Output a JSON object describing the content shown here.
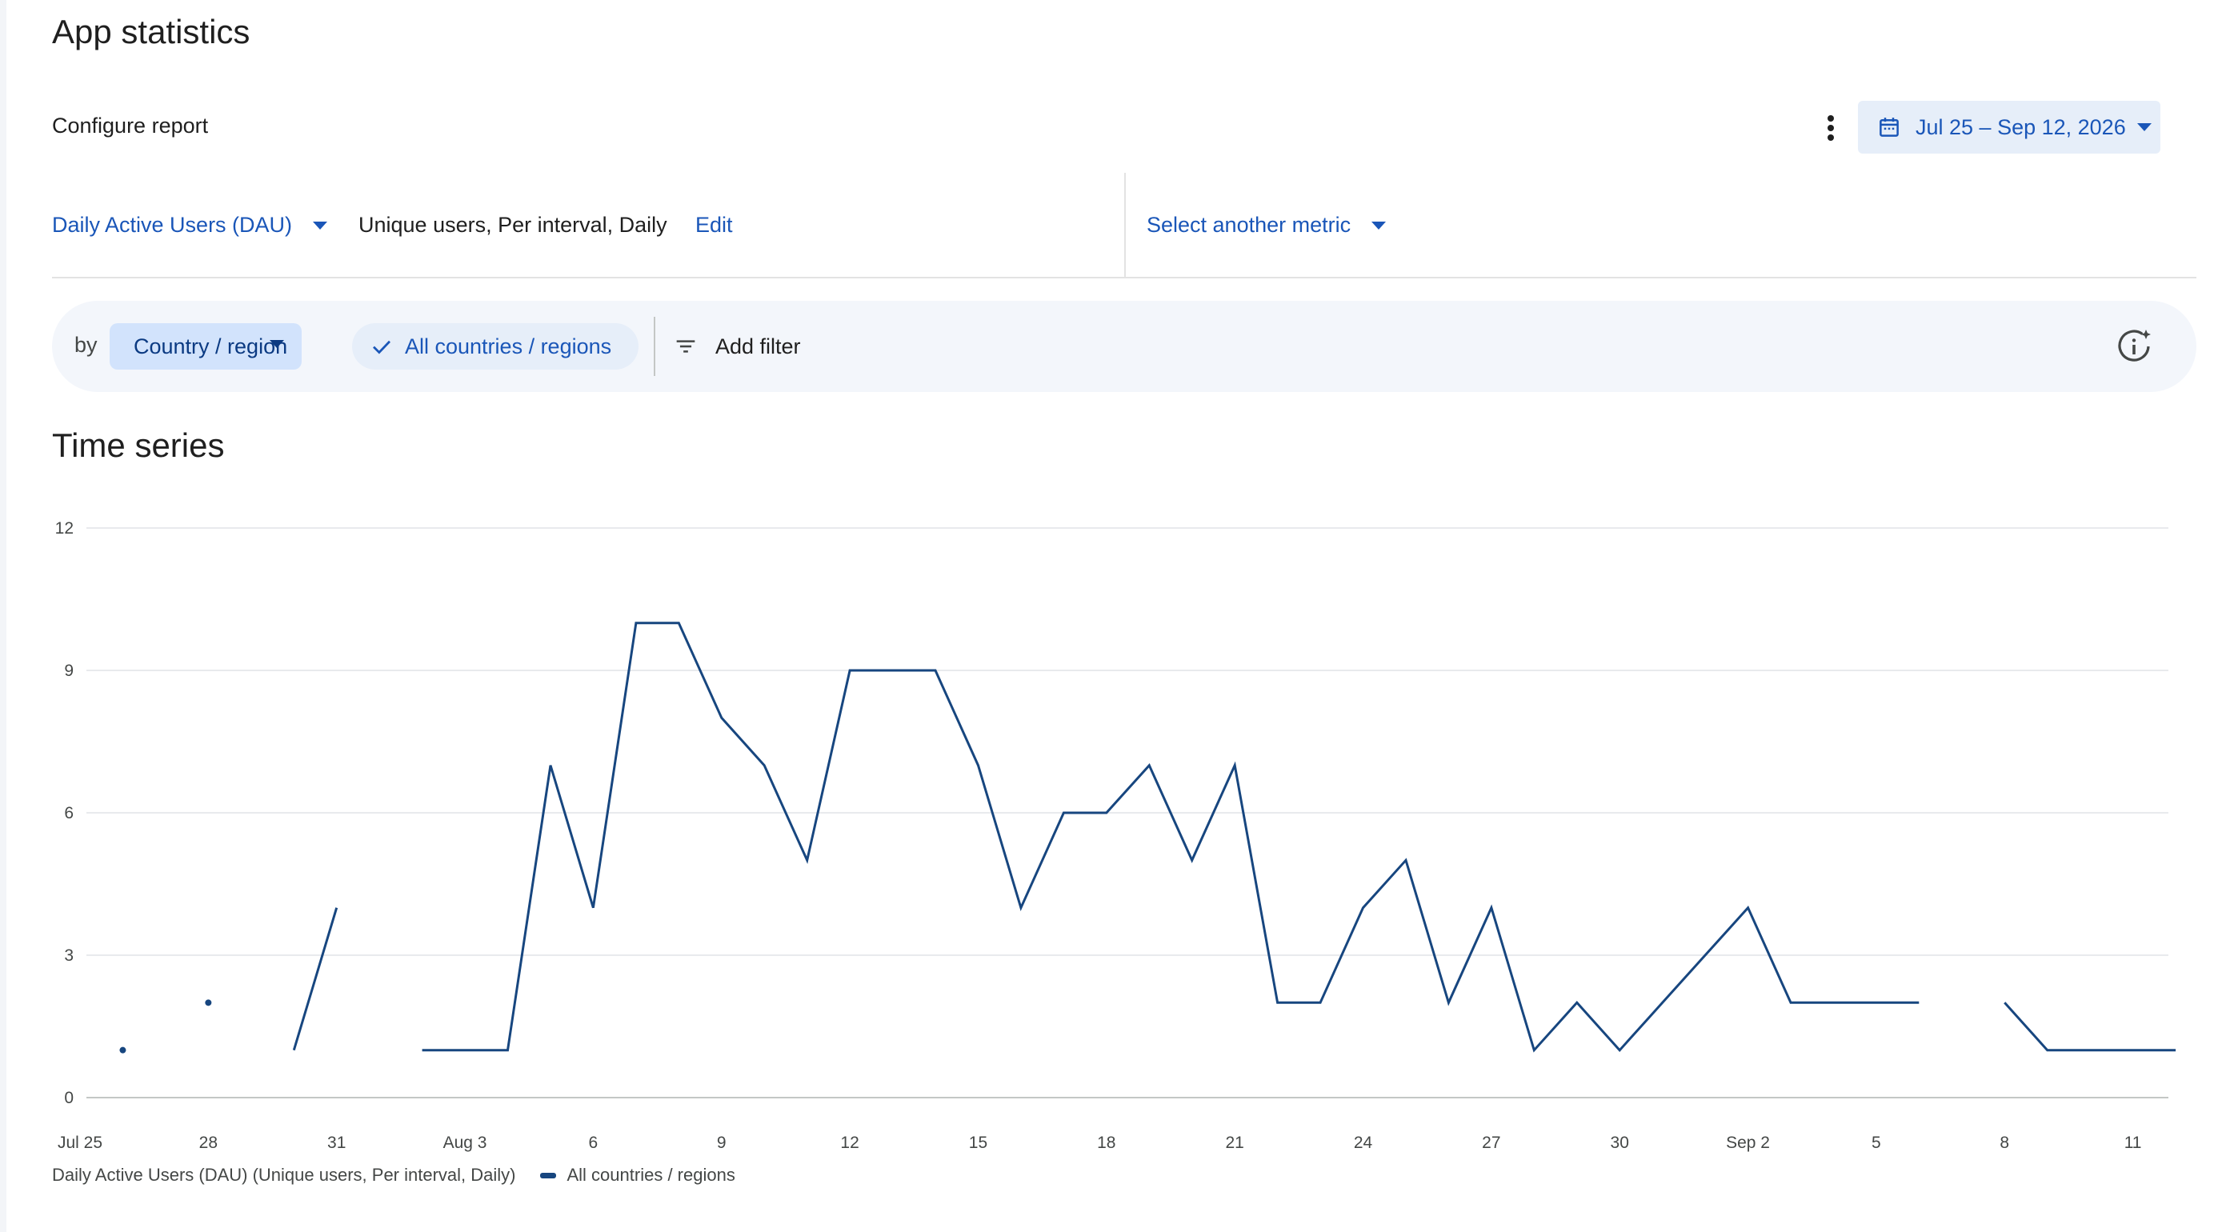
{
  "page": {
    "title": "App statistics"
  },
  "report": {
    "configure_label": "Configure report",
    "date_range": "Jul 25 – Sep 12, 2026",
    "more_icon": "more-vert-icon",
    "calendar_icon": "calendar-icon"
  },
  "metrics": {
    "primary": "Daily Active Users (DAU)",
    "description": "Unique users, Per interval, Daily",
    "edit_label": "Edit",
    "select_another": "Select another metric"
  },
  "filters": {
    "by_label": "by",
    "dimension": "Country / region",
    "selected": "All countries / regions",
    "add_filter": "Add filter",
    "insight_icon": "info-sparkle-icon"
  },
  "section": {
    "title": "Time series"
  },
  "chart_data": {
    "type": "line",
    "y_ticks": [
      "0",
      "3",
      "6",
      "9",
      "12"
    ],
    "ylim": [
      0,
      12
    ],
    "x_tick_labels": [
      "Jul 25",
      "28",
      "31",
      "Aug 3",
      "6",
      "9",
      "12",
      "15",
      "18",
      "21",
      "24",
      "27",
      "30",
      "Sep 2",
      "5",
      "8",
      "11"
    ],
    "x_start": "Jul 25",
    "x_end": "Sep 12",
    "grid": true,
    "legend_label": "Daily Active Users (DAU) (Unique users, Per interval, Daily)",
    "series": [
      {
        "name": "All countries / regions",
        "color": "#17467f",
        "dates": [
          "Jul 25",
          "Jul 26",
          "Jul 27",
          "Jul 28",
          "Jul 29",
          "Jul 30",
          "Jul 31",
          "Aug 1",
          "Aug 2",
          "Aug 3",
          "Aug 4",
          "Aug 5",
          "Aug 6",
          "Aug 7",
          "Aug 8",
          "Aug 9",
          "Aug 10",
          "Aug 11",
          "Aug 12",
          "Aug 13",
          "Aug 14",
          "Aug 15",
          "Aug 16",
          "Aug 17",
          "Aug 18",
          "Aug 19",
          "Aug 20",
          "Aug 21",
          "Aug 22",
          "Aug 23",
          "Aug 24",
          "Aug 25",
          "Aug 26",
          "Aug 27",
          "Aug 28",
          "Aug 29",
          "Aug 30",
          "Aug 31",
          "Sep 1",
          "Sep 2",
          "Sep 3",
          "Sep 4",
          "Sep 5",
          "Sep 6",
          "Sep 7",
          "Sep 8",
          "Sep 9",
          "Sep 10",
          "Sep 11",
          "Sep 12"
        ],
        "values": [
          null,
          1,
          null,
          2,
          null,
          1,
          4,
          null,
          1,
          1,
          1,
          7,
          4,
          10,
          10,
          8,
          7,
          5,
          9,
          9,
          9,
          7,
          4,
          6,
          6,
          7,
          5,
          7,
          2,
          2,
          4,
          5,
          2,
          4,
          1,
          2,
          1,
          2,
          3,
          4,
          2,
          2,
          2,
          2,
          null,
          2,
          1,
          1,
          1,
          1
        ]
      }
    ]
  }
}
